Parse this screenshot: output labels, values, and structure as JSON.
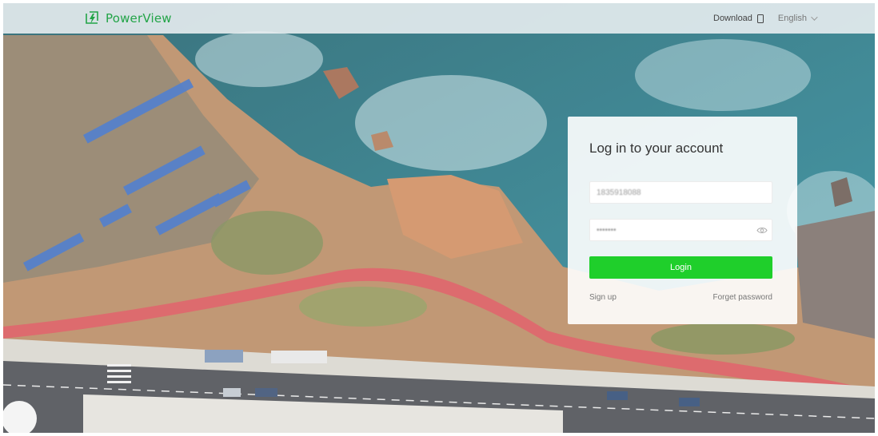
{
  "header": {
    "brand": "PowerView",
    "download_label": "Download",
    "language_label": "English"
  },
  "login": {
    "title": "Log in to your account",
    "account_value": "1835918088",
    "password_value": "•••••••",
    "login_button": "Login",
    "signup_link": "Sign up",
    "forgot_link": "Forget password"
  },
  "colors": {
    "brand_green": "#22a447",
    "button_green": "#1fcf2b"
  },
  "icons": {
    "logo": "lightning-bolt-icon",
    "download": "phone-icon",
    "language": "chevron-down-icon",
    "password_toggle": "eye-icon"
  }
}
